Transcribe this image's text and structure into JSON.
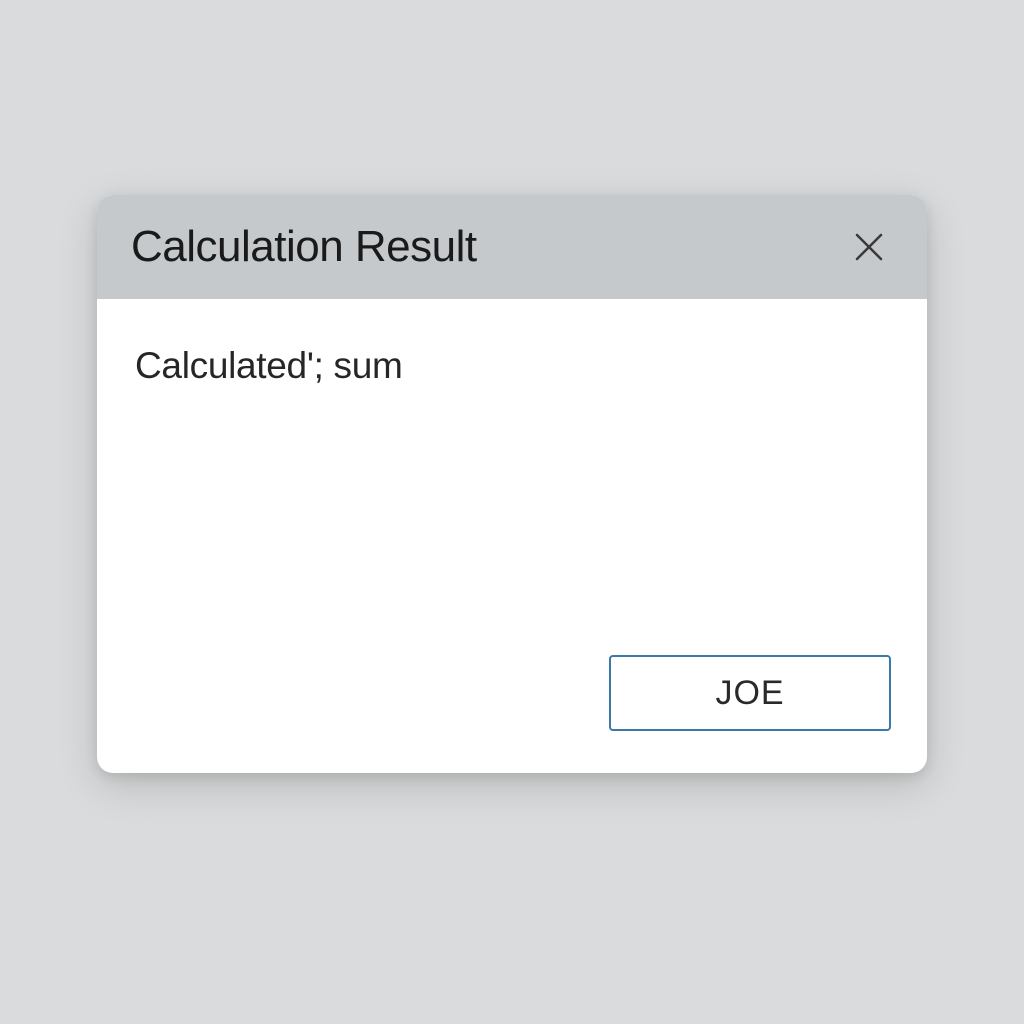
{
  "dialog": {
    "title": "Calculation Result",
    "body_text": "Calculated'; sum",
    "action_button_label": "JOE"
  }
}
